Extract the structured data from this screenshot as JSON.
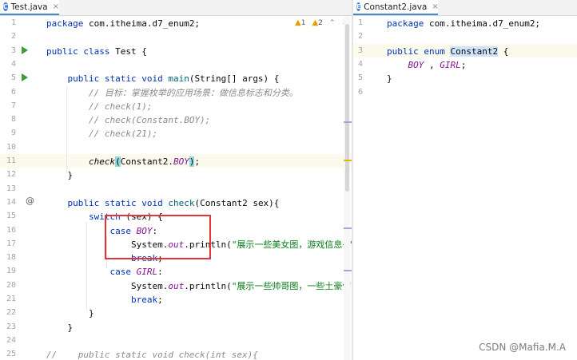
{
  "left_editor": {
    "tab": {
      "label": "Test.java",
      "icon": "java-class-icon"
    },
    "inspections": {
      "warnings": "1",
      "weak_warnings": "2"
    },
    "lines": [
      {
        "num": "1",
        "segs": [
          [
            "kw",
            "package "
          ],
          [
            "",
            "com.itheima.d7_enum2;"
          ]
        ]
      },
      {
        "num": "2",
        "segs": []
      },
      {
        "num": "3",
        "segs": [
          [
            "kw",
            "public class "
          ],
          [
            "",
            "Test {"
          ]
        ],
        "run": true
      },
      {
        "num": "4",
        "segs": []
      },
      {
        "num": "5",
        "segs": [
          [
            "",
            "    "
          ],
          [
            "kw",
            "public static void "
          ],
          [
            "mth",
            "main"
          ],
          [
            "",
            "(String[] args) {"
          ]
        ],
        "run": true
      },
      {
        "num": "6",
        "segs": [
          [
            "",
            "        "
          ],
          [
            "cmt",
            "// 目标：掌握枚举的应用场景：做信息标志和分类。"
          ]
        ]
      },
      {
        "num": "7",
        "segs": [
          [
            "",
            "        "
          ],
          [
            "cmt",
            "// check(1);"
          ]
        ]
      },
      {
        "num": "8",
        "segs": [
          [
            "",
            "        "
          ],
          [
            "cmt",
            "// check(Constant.BOY);"
          ]
        ]
      },
      {
        "num": "9",
        "segs": [
          [
            "",
            "        "
          ],
          [
            "cmt",
            "// check(21);"
          ]
        ]
      },
      {
        "num": "10",
        "segs": []
      },
      {
        "num": "11",
        "segs": [
          [
            "",
            "        "
          ],
          [
            "itc",
            "check"
          ],
          [
            "brk",
            "("
          ],
          [
            "",
            "Constant2."
          ],
          [
            "fld",
            "BOY"
          ],
          [
            "brk",
            ")"
          ],
          [
            "",
            ";"
          ]
        ],
        "current": true
      },
      {
        "num": "12",
        "segs": [
          [
            "",
            "    }"
          ]
        ]
      },
      {
        "num": "13",
        "segs": []
      },
      {
        "num": "14",
        "segs": [
          [
            "",
            "    "
          ],
          [
            "kw",
            "public static void "
          ],
          [
            "mth",
            "check"
          ],
          [
            "",
            "(Constant2 sex){"
          ]
        ],
        "at": true
      },
      {
        "num": "15",
        "segs": [
          [
            "",
            "        "
          ],
          [
            "kw",
            "switch"
          ],
          [
            "",
            " (sex) {"
          ]
        ]
      },
      {
        "num": "16",
        "segs": [
          [
            "",
            "            "
          ],
          [
            "kw",
            "case "
          ],
          [
            "fld",
            "BOY"
          ],
          [
            "",
            ":"
          ]
        ]
      },
      {
        "num": "17",
        "segs": [
          [
            "",
            "                System."
          ],
          [
            "fld",
            "out"
          ],
          [
            "",
            ".println("
          ],
          [
            "str",
            "\"展示一些美女图，游戏信息~\""
          ],
          [
            "",
            ");"
          ]
        ]
      },
      {
        "num": "18",
        "segs": [
          [
            "",
            "                "
          ],
          [
            "kw",
            "break"
          ],
          [
            "",
            ";"
          ]
        ]
      },
      {
        "num": "19",
        "segs": [
          [
            "",
            "            "
          ],
          [
            "kw",
            "case "
          ],
          [
            "fld",
            "GIRL"
          ],
          [
            "",
            ":"
          ]
        ]
      },
      {
        "num": "20",
        "segs": [
          [
            "",
            "                System."
          ],
          [
            "fld",
            "out"
          ],
          [
            "",
            ".println("
          ],
          [
            "str",
            "\"展示一些帅哥图，一些土豪信息~\""
          ]
        ]
      },
      {
        "num": "21",
        "segs": [
          [
            "",
            "                "
          ],
          [
            "kw",
            "break"
          ],
          [
            "",
            ";"
          ]
        ]
      },
      {
        "num": "22",
        "segs": [
          [
            "",
            "        }"
          ]
        ]
      },
      {
        "num": "23",
        "segs": [
          [
            "",
            "    }"
          ]
        ]
      },
      {
        "num": "24",
        "segs": []
      },
      {
        "num": "25",
        "segs": [
          [
            "cmt",
            "//    public static void check(int sex){"
          ]
        ]
      }
    ]
  },
  "right_editor": {
    "tab": {
      "label": "Constant2.java",
      "icon": "java-enum-icon"
    },
    "lines": [
      {
        "num": "1",
        "segs": [
          [
            "kw",
            "package "
          ],
          [
            "",
            "com.itheima.d7_enum2;"
          ]
        ]
      },
      {
        "num": "2",
        "segs": []
      },
      {
        "num": "3",
        "segs": [
          [
            "kw",
            "public enum "
          ],
          [
            "sel",
            "Constant2"
          ],
          [
            "",
            " {"
          ]
        ],
        "current": true
      },
      {
        "num": "4",
        "segs": [
          [
            "",
            "    "
          ],
          [
            "fld",
            "BOY"
          ],
          [
            "",
            " , "
          ],
          [
            "fld",
            "GIRL"
          ],
          [
            "",
            ";"
          ]
        ]
      },
      {
        "num": "5",
        "segs": [
          [
            "",
            "}"
          ]
        ]
      },
      {
        "num": "6",
        "segs": []
      }
    ]
  },
  "tab_close_glyph": "×",
  "override_glyph": "@",
  "watermark": "CSDN @Mafia.M.A",
  "colors": {
    "keyword": "#0033b3",
    "string": "#067d17",
    "comment": "#8c8c8c",
    "field": "#871094",
    "annotation_box": "#e23434"
  }
}
